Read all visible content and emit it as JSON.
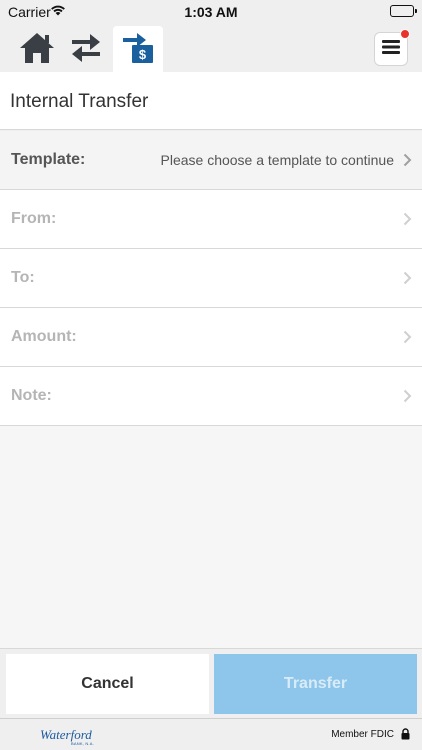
{
  "status_bar": {
    "carrier": "Carrier",
    "time": "1:03 AM"
  },
  "nav": {
    "items": [
      {
        "icon": "home-icon"
      },
      {
        "icon": "transfer-arrows-icon"
      },
      {
        "icon": "internal-transfer-icon",
        "active": true
      }
    ],
    "menu_icon": "hamburger-menu-icon",
    "notification_color": "#e8322b"
  },
  "page": {
    "title": "Internal Transfer"
  },
  "form": {
    "template_label": "Template:",
    "template_value": "Please choose a template to continue",
    "from_label": "From:",
    "to_label": "To:",
    "amount_label": "Amount:",
    "note_label": "Note:"
  },
  "actions": {
    "cancel_label": "Cancel",
    "transfer_label": "Transfer",
    "transfer_color": "#8ec5ea"
  },
  "footer": {
    "brand_name": "Waterford",
    "brand_sub": "BANK, N.A.",
    "fdic_text": "Member FDIC"
  }
}
